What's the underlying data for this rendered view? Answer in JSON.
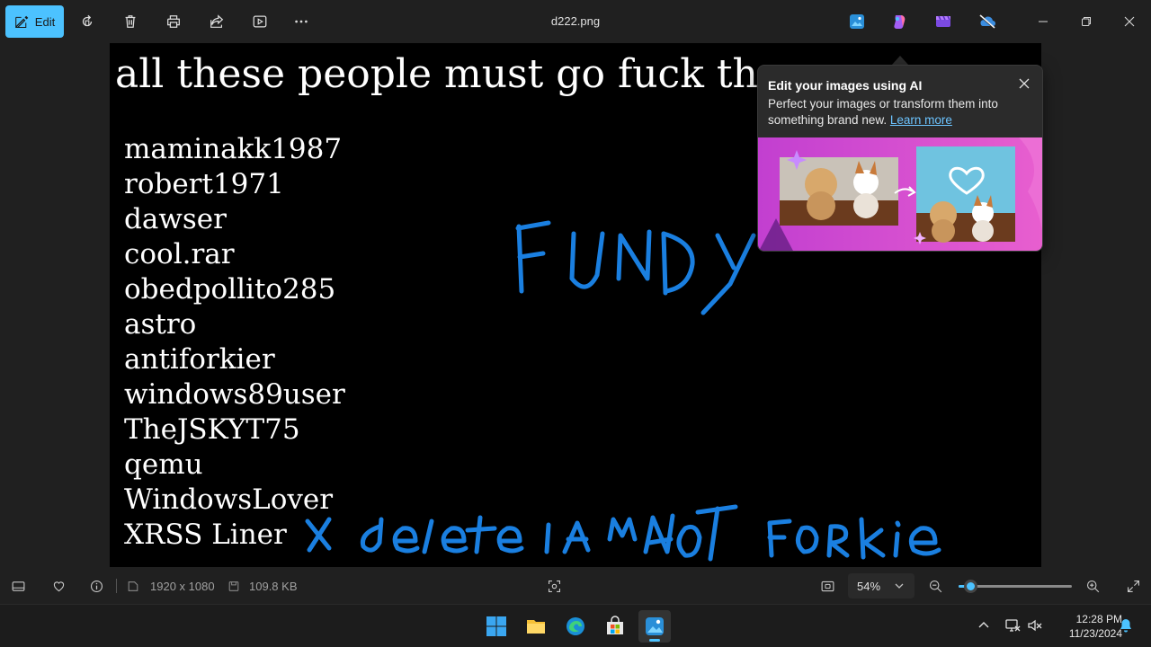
{
  "toolbar": {
    "edit_label": "Edit",
    "file_name": "d222.png",
    "buttons": [
      "rotate",
      "delete",
      "print",
      "share",
      "slideshow",
      "more"
    ]
  },
  "canvas": {
    "headline": "all these people must go fuck th",
    "names": [
      "maminakk1987",
      "robert1971",
      "dawser",
      "cool.rar",
      "obedpollito285",
      "astro",
      "antiforkier",
      "windows89user",
      "TheJSKYT75",
      "qemu",
      "WindowsLover",
      "XRSS Liner"
    ]
  },
  "ai_popup": {
    "title": "Edit your images using AI",
    "body": "Perfect your images or transform them into something brand new.",
    "link": "Learn more"
  },
  "status": {
    "dimensions": "1920 x 1080",
    "file_size": "109.8 KB",
    "zoom": "54%",
    "zoom_level": 0.1
  },
  "taskbar": {
    "time": "12:28 PM",
    "date": "11/23/2024"
  },
  "colors": {
    "accent": "#4cc2ff",
    "ink": "#1a7fe0",
    "background": "#202020"
  }
}
